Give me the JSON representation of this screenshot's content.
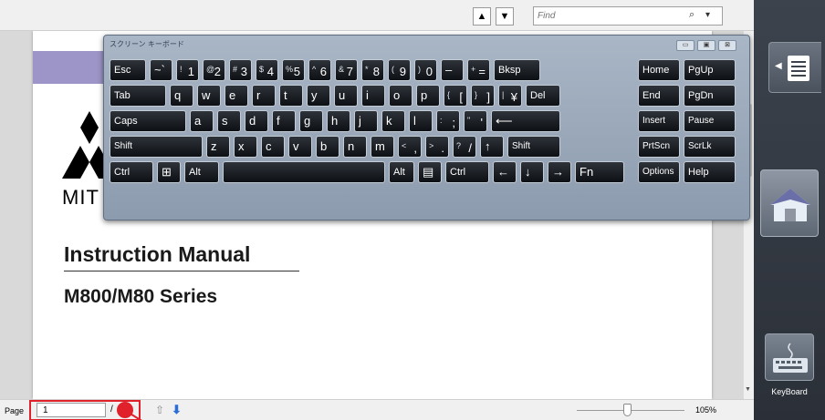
{
  "toolbar": {
    "prev_symbol": "▲",
    "next_symbol": "▼",
    "find_placeholder": "Find",
    "find_icon": "search-icon",
    "find_dropdown": "▾"
  },
  "document": {
    "company_text": "MIT",
    "title": "Instruction Manual",
    "series": "M800/M80 Series",
    "band_color": "#9d94c7"
  },
  "osk": {
    "title": "スクリーン キーボード",
    "controls": [
      "▭",
      "▣",
      "⊠"
    ],
    "keys": [
      {
        "name": "esc",
        "label": "Esc"
      },
      {
        "name": "tilde",
        "label": "~`"
      },
      {
        "name": "1",
        "sup": "!",
        "label": "1"
      },
      {
        "name": "2",
        "sup": "@",
        "label": "2"
      },
      {
        "name": "3",
        "sup": "#",
        "label": "3"
      },
      {
        "name": "4",
        "sup": "$",
        "label": "4"
      },
      {
        "name": "5",
        "sup": "%",
        "label": "5"
      },
      {
        "name": "6",
        "sup": "^",
        "label": "6"
      },
      {
        "name": "7",
        "sup": "&",
        "label": "7"
      },
      {
        "name": "8",
        "sup": "*",
        "label": "8"
      },
      {
        "name": "9",
        "sup": "(",
        "label": "9"
      },
      {
        "name": "0",
        "sup": ")",
        "label": "0"
      },
      {
        "name": "minus",
        "label": "–"
      },
      {
        "name": "equals",
        "sup": "+",
        "label": "="
      },
      {
        "name": "bksp",
        "label": "Bksp"
      },
      {
        "name": "home",
        "label": "Home"
      },
      {
        "name": "pgup",
        "label": "PgUp"
      },
      {
        "name": "tab",
        "label": "Tab"
      },
      {
        "name": "q",
        "label": "q"
      },
      {
        "name": "w",
        "label": "w"
      },
      {
        "name": "e",
        "label": "e"
      },
      {
        "name": "r",
        "label": "r"
      },
      {
        "name": "t",
        "label": "t"
      },
      {
        "name": "y",
        "label": "y"
      },
      {
        "name": "u",
        "label": "u"
      },
      {
        "name": "i",
        "label": "i"
      },
      {
        "name": "o",
        "label": "o"
      },
      {
        "name": "p",
        "label": "p"
      },
      {
        "name": "bracket-open",
        "sup": "{",
        "label": "["
      },
      {
        "name": "bracket-close",
        "sup": "}",
        "label": "]"
      },
      {
        "name": "yen",
        "sup": "|",
        "label": "¥"
      },
      {
        "name": "del",
        "label": "Del"
      },
      {
        "name": "end",
        "label": "End"
      },
      {
        "name": "pgdn",
        "label": "PgDn"
      },
      {
        "name": "caps",
        "label": "Caps"
      },
      {
        "name": "a",
        "label": "a"
      },
      {
        "name": "s",
        "label": "s"
      },
      {
        "name": "d",
        "label": "d"
      },
      {
        "name": "f",
        "label": "f"
      },
      {
        "name": "g",
        "label": "g"
      },
      {
        "name": "h",
        "label": "h"
      },
      {
        "name": "j",
        "label": "j"
      },
      {
        "name": "k",
        "label": "k"
      },
      {
        "name": "l",
        "label": "l"
      },
      {
        "name": "semicolon",
        "sup": ":",
        "label": ";"
      },
      {
        "name": "quote",
        "sup": "\"",
        "label": "'"
      },
      {
        "name": "enter",
        "label": "⟵"
      },
      {
        "name": "insert",
        "label": "Insert"
      },
      {
        "name": "pause",
        "label": "Pause"
      },
      {
        "name": "shift-left",
        "label": "Shift"
      },
      {
        "name": "z",
        "label": "z"
      },
      {
        "name": "x",
        "label": "x"
      },
      {
        "name": "c",
        "label": "c"
      },
      {
        "name": "v",
        "label": "v"
      },
      {
        "name": "b",
        "label": "b"
      },
      {
        "name": "n",
        "label": "n"
      },
      {
        "name": "m",
        "label": "m"
      },
      {
        "name": "comma",
        "sup": "<",
        "label": ","
      },
      {
        "name": "period",
        "sup": ">",
        "label": "."
      },
      {
        "name": "slash",
        "sup": "?",
        "label": "/"
      },
      {
        "name": "up",
        "label": "↑"
      },
      {
        "name": "shift-right",
        "label": "Shift"
      },
      {
        "name": "prtscn",
        "label": "PrtScn"
      },
      {
        "name": "scrlk",
        "label": "ScrLk"
      },
      {
        "name": "ctrl-left",
        "label": "Ctrl"
      },
      {
        "name": "win",
        "label": "⊞"
      },
      {
        "name": "alt-left",
        "label": "Alt"
      },
      {
        "name": "space",
        "label": ""
      },
      {
        "name": "alt-right",
        "label": "Alt"
      },
      {
        "name": "menu",
        "label": "▤"
      },
      {
        "name": "ctrl-right",
        "label": "Ctrl"
      },
      {
        "name": "left",
        "label": "←"
      },
      {
        "name": "down",
        "label": "↓"
      },
      {
        "name": "right",
        "label": "→"
      },
      {
        "name": "fn",
        "label": "Fn"
      },
      {
        "name": "options",
        "label": "Options"
      },
      {
        "name": "help",
        "label": "Help"
      }
    ]
  },
  "right_panel": {
    "menu_icon": "list-icon",
    "home_icon": "home-icon",
    "keyboard_icon": "keyboard-icon",
    "keyboard_label": "KeyBoard"
  },
  "status": {
    "page_label": "Page",
    "page_value": "1",
    "page_separator": "/",
    "zoom_label": "105%",
    "zoom_fraction": 0.47,
    "highlight_color": "#e0202a"
  }
}
